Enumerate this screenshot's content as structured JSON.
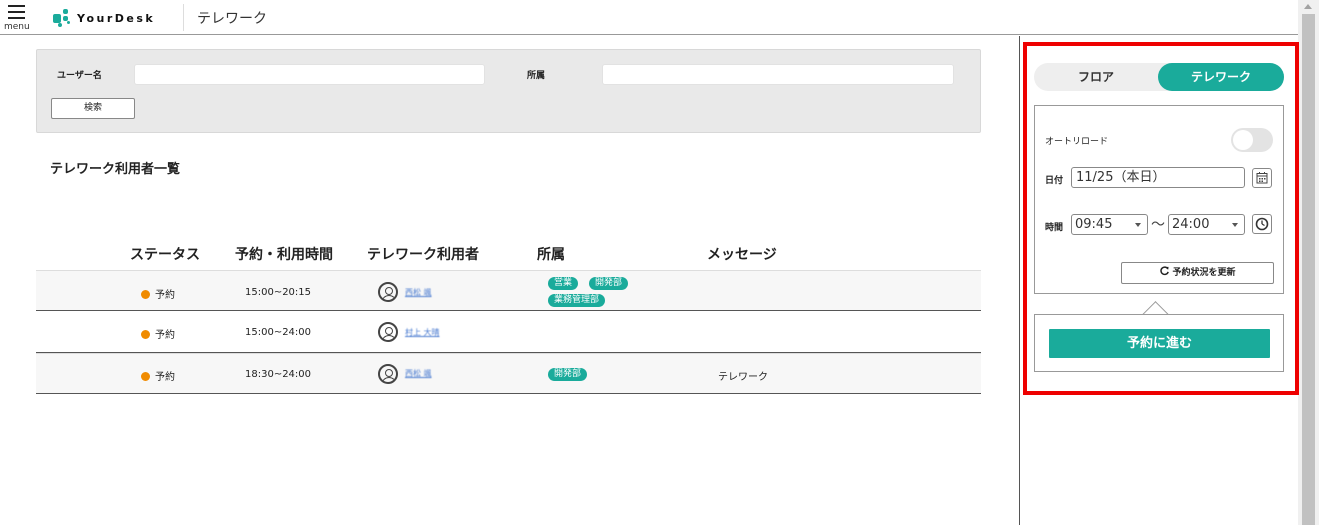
{
  "header": {
    "menu_label": "menu",
    "logo_text": "YourDesk",
    "page_title": "テレワーク"
  },
  "search": {
    "user_label": "ユーザー名",
    "user_value": "",
    "dept_label": "所属",
    "dept_value": "",
    "search_button": "検索"
  },
  "list": {
    "title": "テレワーク利用者一覧",
    "columns": [
      "ステータス",
      "予約・利用時間",
      "テレワーク利用者",
      "所属",
      "メッセージ"
    ],
    "rows": [
      {
        "status": "予約",
        "time": "15:00~20:15",
        "user": "西松 颯",
        "tags": [
          "営業",
          "開発部",
          "業務管理部"
        ],
        "message": ""
      },
      {
        "status": "予約",
        "time": "15:00~24:00",
        "user": "村上 大晴",
        "tags": [],
        "message": ""
      },
      {
        "status": "予約",
        "time": "18:30~24:00",
        "user": "西松 颯",
        "tags": [
          "開発部"
        ],
        "message": "テレワーク"
      }
    ]
  },
  "side": {
    "tab_floor": "フロア",
    "tab_telework": "テレワーク",
    "active_tab": "テレワーク",
    "autoreload_label": "オートリロード",
    "autoreload_on": false,
    "date_label": "日付",
    "date_value": "11/25（本日）",
    "time_label": "時間",
    "time_from": "09:45",
    "time_sep": "〜",
    "time_to": "24:00",
    "refresh_button": "予約状況を更新",
    "go_button": "予約に進む"
  },
  "colors": {
    "accent": "#1aab9b",
    "status_dot": "#f08b00",
    "highlight_frame": "#ee0000"
  }
}
